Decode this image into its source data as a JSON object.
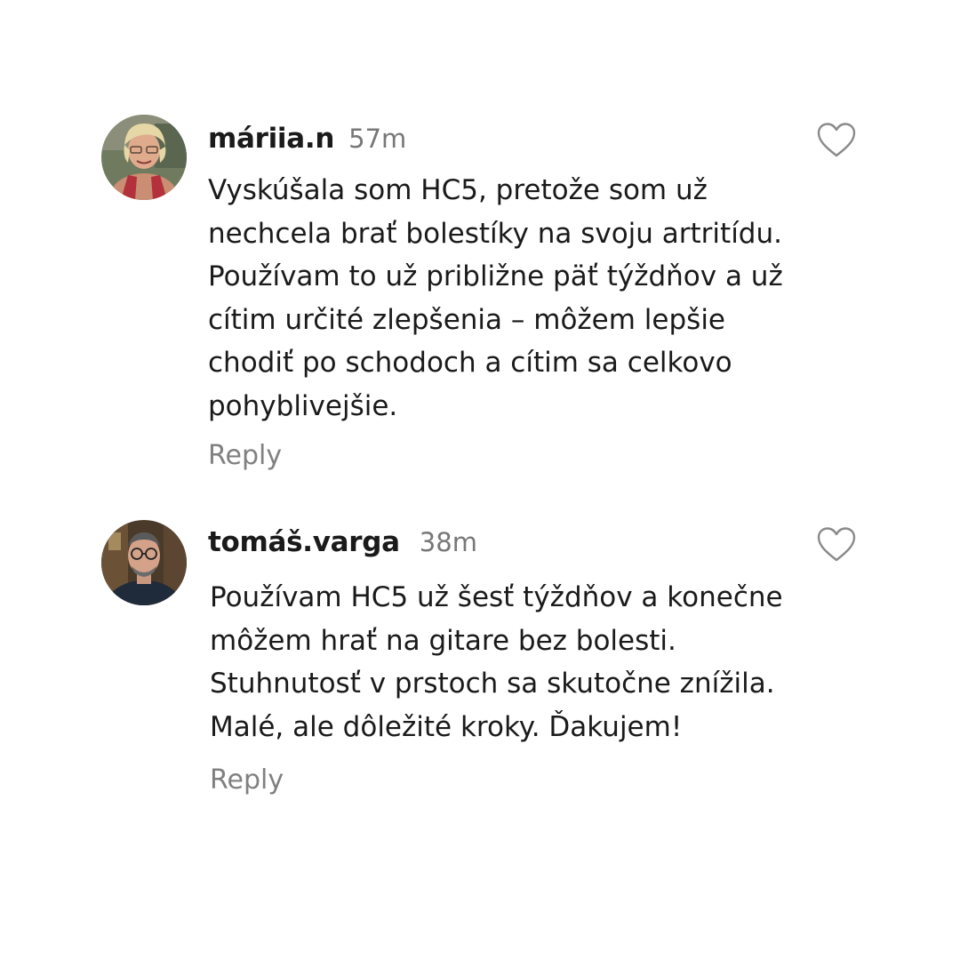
{
  "comments": [
    {
      "username": "máriia.n",
      "time": "57m",
      "lines": [
        "Vyskúšala som HC5, pretože som už",
        "nechcela brať bolestíky na svoju artritídu.",
        "Používam to už približne päť týždňov a už",
        "cítim určité zlepšenia – môžem lepšie",
        "chodiť po schodoch a cítim sa celkovo",
        "pohyblivejšie."
      ],
      "reply_label": "Reply",
      "avatar_icon": "avatar-photo-woman",
      "like_icon": "heart-outline-icon"
    },
    {
      "username": "tomáš.varga",
      "time": "38m",
      "lines": [
        "Používam HC5 už šesť týždňov a konečne",
        "môžem hrať na gitare bez bolesti.",
        "Stuhnutosť v prstoch sa skutočne znížila.",
        "Malé, ale dôležité kroky. Ďakujem!"
      ],
      "reply_label": "Reply",
      "avatar_icon": "avatar-photo-man",
      "like_icon": "heart-outline-icon"
    }
  ],
  "colors": {
    "text": "#1a1a1a",
    "muted": "#777777",
    "reply": "#808080",
    "heart_stroke": "#8a8a8a",
    "background": "#ffffff"
  }
}
